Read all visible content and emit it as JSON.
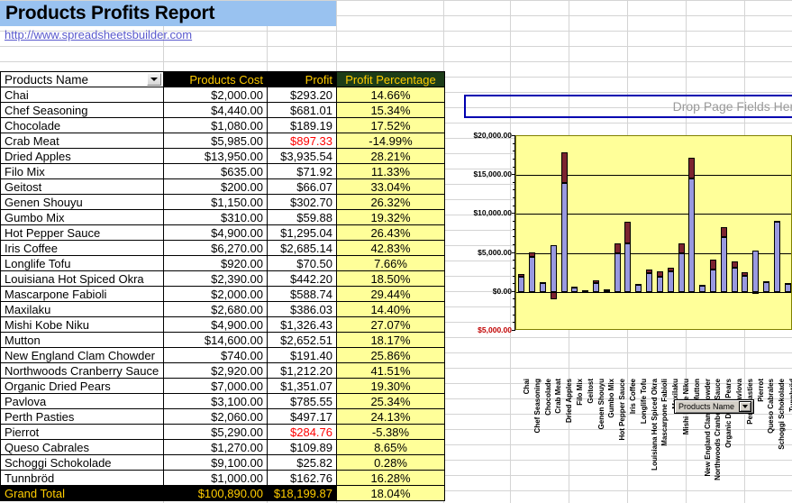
{
  "title": "Products Profits Report",
  "url": "http://www.spreadsheetsbuilder.com",
  "table": {
    "headers": {
      "name": "Products Name",
      "cost": "Products Cost",
      "profit": "Profit",
      "pct": "Profit Percentage"
    },
    "rows": [
      {
        "name": "Chai",
        "cost": "$2,000.00",
        "profit": "$293.20",
        "pct": "14.66%",
        "negative": false
      },
      {
        "name": "Chef Seasoning",
        "cost": "$4,440.00",
        "profit": "$681.01",
        "pct": "15.34%",
        "negative": false
      },
      {
        "name": "Chocolade",
        "cost": "$1,080.00",
        "profit": "$189.19",
        "pct": "17.52%",
        "negative": false
      },
      {
        "name": "Crab Meat",
        "cost": "$5,985.00",
        "profit": "$897.33",
        "pct": "-14.99%",
        "negative": true
      },
      {
        "name": "Dried Apples",
        "cost": "$13,950.00",
        "profit": "$3,935.54",
        "pct": "28.21%",
        "negative": false
      },
      {
        "name": "Filo Mix",
        "cost": "$635.00",
        "profit": "$71.92",
        "pct": "11.33%",
        "negative": false
      },
      {
        "name": "Geitost",
        "cost": "$200.00",
        "profit": "$66.07",
        "pct": "33.04%",
        "negative": false
      },
      {
        "name": "Genen Shouyu",
        "cost": "$1,150.00",
        "profit": "$302.70",
        "pct": "26.32%",
        "negative": false
      },
      {
        "name": "Gumbo Mix",
        "cost": "$310.00",
        "profit": "$59.88",
        "pct": "19.32%",
        "negative": false
      },
      {
        "name": "Hot Pepper Sauce",
        "cost": "$4,900.00",
        "profit": "$1,295.04",
        "pct": "26.43%",
        "negative": false
      },
      {
        "name": "Iris Coffee",
        "cost": "$6,270.00",
        "profit": "$2,685.14",
        "pct": "42.83%",
        "negative": false
      },
      {
        "name": "Longlife Tofu",
        "cost": "$920.00",
        "profit": "$70.50",
        "pct": "7.66%",
        "negative": false
      },
      {
        "name": "Louisiana Hot Spiced Okra",
        "cost": "$2,390.00",
        "profit": "$442.20",
        "pct": "18.50%",
        "negative": false
      },
      {
        "name": "Mascarpone Fabioli",
        "cost": "$2,000.00",
        "profit": "$588.74",
        "pct": "29.44%",
        "negative": false
      },
      {
        "name": "Maxilaku",
        "cost": "$2,680.00",
        "profit": "$386.03",
        "pct": "14.40%",
        "negative": false
      },
      {
        "name": "Mishi Kobe Niku",
        "cost": "$4,900.00",
        "profit": "$1,326.43",
        "pct": "27.07%",
        "negative": false
      },
      {
        "name": "Mutton",
        "cost": "$14,600.00",
        "profit": "$2,652.51",
        "pct": "18.17%",
        "negative": false
      },
      {
        "name": "New England Clam Chowder",
        "cost": "$740.00",
        "profit": "$191.40",
        "pct": "25.86%",
        "negative": false
      },
      {
        "name": "Northwoods Cranberry Sauce",
        "cost": "$2,920.00",
        "profit": "$1,212.20",
        "pct": "41.51%",
        "negative": false
      },
      {
        "name": "Organic Dried Pears",
        "cost": "$7,000.00",
        "profit": "$1,351.07",
        "pct": "19.30%",
        "negative": false
      },
      {
        "name": "Pavlova",
        "cost": "$3,100.00",
        "profit": "$785.55",
        "pct": "25.34%",
        "negative": false
      },
      {
        "name": "Perth Pasties",
        "cost": "$2,060.00",
        "profit": "$497.17",
        "pct": "24.13%",
        "negative": false
      },
      {
        "name": "Pierrot",
        "cost": "$5,290.00",
        "profit": "$284.76",
        "pct": "-5.38%",
        "negative": true
      },
      {
        "name": "Queso Cabrales",
        "cost": "$1,270.00",
        "profit": "$109.89",
        "pct": "8.65%",
        "negative": false
      },
      {
        "name": "Schoggi Schokolade",
        "cost": "$9,100.00",
        "profit": "$25.82",
        "pct": "0.28%",
        "negative": false
      },
      {
        "name": "Tunnbröd",
        "cost": "$1,000.00",
        "profit": "$162.76",
        "pct": "16.28%",
        "negative": false
      }
    ],
    "grand_total": {
      "name": "Grand Total",
      "cost": "$100,890.00",
      "profit": "$18,199.87",
      "pct": "18.04%"
    }
  },
  "chart": {
    "drop_page_fields_label": "Drop Page Fields Here",
    "field_button_label": "Products Name",
    "colors": {
      "plot_background": "#ffff99",
      "cost_series": "#9999e0",
      "profit_series": "#7c2430",
      "negative_tick": "#c00000",
      "header_accent": "#ffcc00",
      "title_background": "#99c2f0",
      "percentage_background": "#ffff99"
    }
  },
  "chart_data": {
    "type": "bar",
    "title": "",
    "xlabel": "",
    "ylabel": "",
    "ylim": [
      -5000,
      20000
    ],
    "yticks": [
      "$20,000.00",
      "$15,000.00",
      "$10,000.00",
      "$5,000.00",
      "$0.00",
      "$5,000.00"
    ],
    "ytick_values": [
      20000,
      15000,
      10000,
      5000,
      0,
      -5000
    ],
    "grid": true,
    "stacked": true,
    "legend": "none",
    "categories": [
      "Chai",
      "Chef Seasoning",
      "Chocolade",
      "Crab Meat",
      "Dried Apples",
      "Filo Mix",
      "Geitost",
      "Genen Shouyu",
      "Gumbo Mix",
      "Hot Pepper Sauce",
      "Iris Coffee",
      "Longlife Tofu",
      "Louisiana Hot Spiced Okra",
      "Mascarpone Fabioli",
      "Maxilaku",
      "Mishi Kobe Niku",
      "Mutton",
      "New England Clam Chowder",
      "Northwoods Cranberry Sauce",
      "Organic Dried Pears",
      "Pavlova",
      "Perth Pasties",
      "Pierrot",
      "Queso Cabrales",
      "Schoggi Schokolade",
      "Tunnbröd"
    ],
    "series": [
      {
        "name": "Products Cost",
        "values": [
          2000,
          4440,
          1080,
          5985,
          13950,
          635,
          200,
          1150,
          310,
          4900,
          6270,
          920,
          2390,
          2000,
          2680,
          4900,
          14600,
          740,
          2920,
          7000,
          3100,
          2060,
          5290,
          1270,
          9100,
          1000
        ]
      },
      {
        "name": "Profit",
        "values": [
          293.2,
          681.01,
          189.19,
          -897.33,
          3935.54,
          71.92,
          66.07,
          302.7,
          59.88,
          1295.04,
          2685.14,
          70.5,
          442.2,
          588.74,
          386.03,
          1326.43,
          2652.51,
          191.4,
          1212.2,
          1351.07,
          785.55,
          497.17,
          -284.76,
          109.89,
          25.82,
          162.76
        ]
      }
    ]
  }
}
